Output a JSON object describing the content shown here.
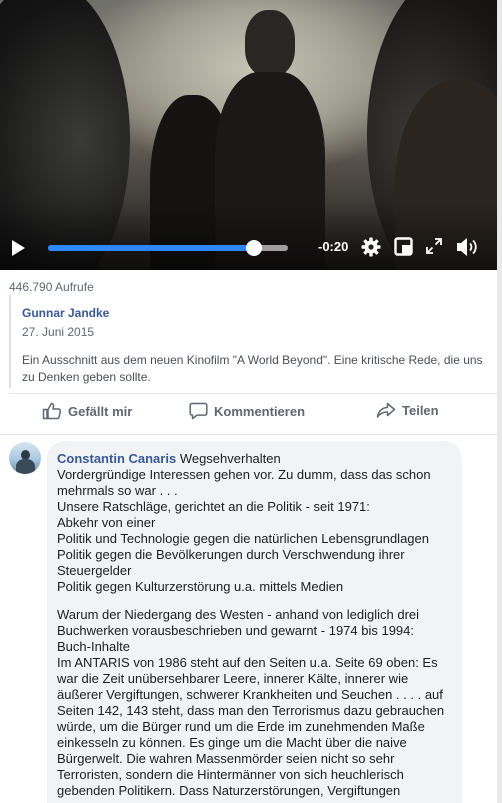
{
  "video": {
    "time_remaining": "-0:20",
    "progress_fraction": 0.86,
    "accent_color": "#2d88ff",
    "icons": [
      "play-icon",
      "gear-icon",
      "pip-icon",
      "fullscreen-icon",
      "volume-icon"
    ]
  },
  "views": "446.790 Aufrufe",
  "post": {
    "author": "Gunnar Jandke",
    "date": "27. Juni 2015",
    "description": "Ein Ausschnitt aus dem neuen Kinofilm \"A World Beyond\". Eine kritische Rede, die uns zu Denken geben sollte."
  },
  "actions": {
    "like": "Gefällt mir",
    "comment": "Kommentieren",
    "share": "Teilen"
  },
  "comment": {
    "author": "Constantin Canaris",
    "title": "Wegsehverhalten",
    "lines": [
      "Vordergründige Interessen gehen vor. Zu dumm, dass das schon",
      "mehrmals so war . . .",
      "Unsere Ratschläge, gerichtet an die Politik - seit 1971:",
      "Abkehr von einer",
      "Politik und Technologie gegen die natürlichen Lebensgrundlagen",
      "Politik gegen die Bevölkerungen durch Verschwendung ihrer",
      "Steuergelder",
      "Politik gegen Kulturzerstörung u.a. mittels Medien",
      "",
      "Warum der Niedergang des Westen - anhand von lediglich drei",
      "Buchwerken vorausbeschrieben und gewarnt - 1974 bis 1994:",
      "Buch-Inhalte",
      "Im ANTARIS von 1986 steht auf den Seiten u.a. Seite 69 oben: Es",
      "war die Zeit unübersehbarer Leere, innerer Kälte, innerer wie",
      "äußerer Vergiftungen, schwerer Krankheiten und Seuchen . . . . auf",
      "Seiten 142, 143 steht, dass man den Terrorismus dazu gebrauchen",
      "würde, um die Bürger rund um die Erde im zunehmenden Maße",
      "einkesseln zu können. Es ginge um die Macht über die naive",
      "Bürgerwelt. Die wahren Massenmörder seien nicht so sehr",
      "Terroristen, sondern die Hintermänner von sich heuchlerisch",
      "gebenden Politikern. Dass Naturzerstörungen, Vergiftungen"
    ]
  }
}
